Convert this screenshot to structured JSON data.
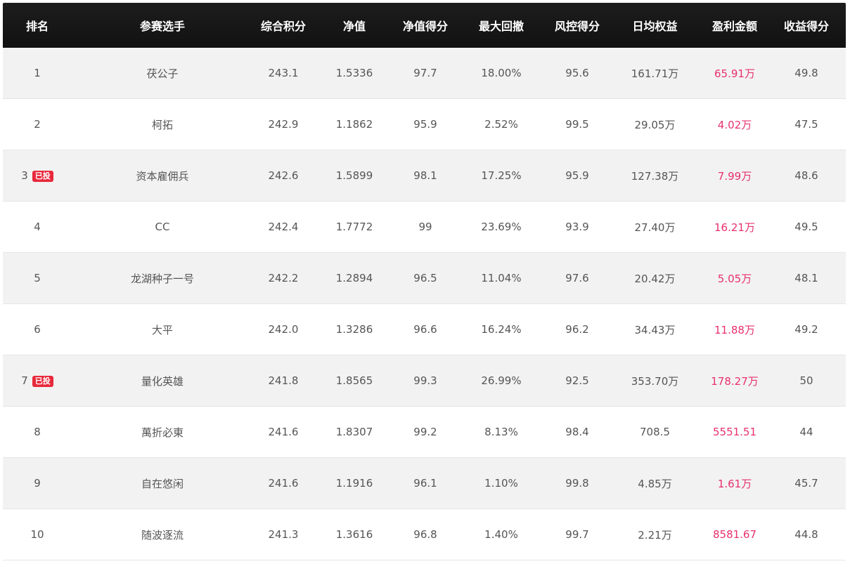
{
  "headers": [
    "排名",
    "参赛选手",
    "综合积分",
    "净值",
    "净值得分",
    "最大回撤",
    "风控得分",
    "日均权益",
    "盈利金额",
    "收益得分"
  ],
  "colors": {
    "header_bg": "#111111",
    "profit": "#e8306e",
    "badge": "#e8293c",
    "row_alt": "#f2f2f2"
  },
  "rows": [
    {
      "rank": "1",
      "badge": "",
      "name": "茯公子",
      "score": "243.1",
      "nav": "1.5336",
      "nav_score": "97.7",
      "max_drawdown": "18.00%",
      "risk_score": "95.6",
      "daily_equity": "161.71万",
      "profit": "65.91万",
      "return_score": "49.8"
    },
    {
      "rank": "2",
      "badge": "",
      "name": "柯拓",
      "score": "242.9",
      "nav": "1.1862",
      "nav_score": "95.9",
      "max_drawdown": "2.52%",
      "risk_score": "99.5",
      "daily_equity": "29.05万",
      "profit": "4.02万",
      "return_score": "47.5"
    },
    {
      "rank": "3",
      "badge": "已投",
      "name": "资本雇佣兵",
      "score": "242.6",
      "nav": "1.5899",
      "nav_score": "98.1",
      "max_drawdown": "17.25%",
      "risk_score": "95.9",
      "daily_equity": "127.38万",
      "profit": "7.99万",
      "return_score": "48.6"
    },
    {
      "rank": "4",
      "badge": "",
      "name": "CC",
      "score": "242.4",
      "nav": "1.7772",
      "nav_score": "99",
      "max_drawdown": "23.69%",
      "risk_score": "93.9",
      "daily_equity": "27.40万",
      "profit": "16.21万",
      "return_score": "49.5"
    },
    {
      "rank": "5",
      "badge": "",
      "name": "龙湖种子一号",
      "score": "242.2",
      "nav": "1.2894",
      "nav_score": "96.5",
      "max_drawdown": "11.04%",
      "risk_score": "97.6",
      "daily_equity": "20.42万",
      "profit": "5.05万",
      "return_score": "48.1"
    },
    {
      "rank": "6",
      "badge": "",
      "name": "大平",
      "score": "242.0",
      "nav": "1.3286",
      "nav_score": "96.6",
      "max_drawdown": "16.24%",
      "risk_score": "96.2",
      "daily_equity": "34.43万",
      "profit": "11.88万",
      "return_score": "49.2"
    },
    {
      "rank": "7",
      "badge": "已投",
      "name": "量化英雄",
      "score": "241.8",
      "nav": "1.8565",
      "nav_score": "99.3",
      "max_drawdown": "26.99%",
      "risk_score": "92.5",
      "daily_equity": "353.70万",
      "profit": "178.27万",
      "return_score": "50"
    },
    {
      "rank": "8",
      "badge": "",
      "name": "萬折必東",
      "score": "241.6",
      "nav": "1.8307",
      "nav_score": "99.2",
      "max_drawdown": "8.13%",
      "risk_score": "98.4",
      "daily_equity": "708.5",
      "profit": "5551.51",
      "return_score": "44"
    },
    {
      "rank": "9",
      "badge": "",
      "name": "自在悠闲",
      "score": "241.6",
      "nav": "1.1916",
      "nav_score": "96.1",
      "max_drawdown": "1.10%",
      "risk_score": "99.8",
      "daily_equity": "4.85万",
      "profit": "1.61万",
      "return_score": "45.7"
    },
    {
      "rank": "10",
      "badge": "",
      "name": "随波逐流",
      "score": "241.3",
      "nav": "1.3616",
      "nav_score": "96.8",
      "max_drawdown": "1.40%",
      "risk_score": "99.7",
      "daily_equity": "2.21万",
      "profit": "8581.67",
      "return_score": "44.8"
    }
  ]
}
